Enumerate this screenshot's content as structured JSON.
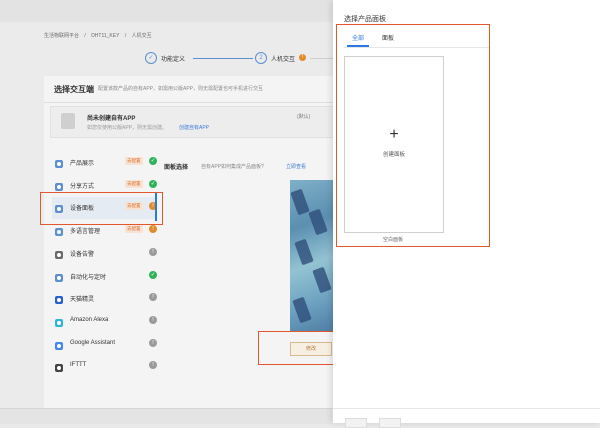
{
  "breadcrumb": {
    "items": [
      "生活物联网平台",
      "/",
      "DHT11_KEY",
      "/",
      "人机交互"
    ]
  },
  "steps": [
    {
      "num": "✓",
      "label": "功能定义"
    },
    {
      "num": "2",
      "label": "人机交互"
    }
  ],
  "section": {
    "title": "选择交互端",
    "desc": "配置该款产品的自有APP。如需用公版APP，则无需配置也可手机进行交互"
  },
  "app_card": {
    "title": "尚未创建自有APP",
    "subtitle": "如您仅使用公版APP，则无需创建。",
    "link": "创建自有APP",
    "default_label": "(默认)"
  },
  "menu": [
    {
      "label": "产品展示",
      "tag": "去配置",
      "status": "ok",
      "status_glyph": "✓",
      "icon": "product-display-icon"
    },
    {
      "label": "分享方式",
      "tag": "去配置",
      "status": "ok",
      "status_glyph": "✓",
      "icon": "share-icon"
    },
    {
      "label": "设备面板",
      "tag": "去配置",
      "status": "warn",
      "status_glyph": "!",
      "icon": "device-panel-icon"
    },
    {
      "label": "多语言管理",
      "tag": "去配置",
      "status": "warn",
      "status_glyph": "!",
      "icon": "language-icon"
    },
    {
      "label": "设备告警",
      "tag": "",
      "status": "gray",
      "status_glyph": "!",
      "icon": "alarm-icon"
    },
    {
      "label": "自动化与定时",
      "tag": "",
      "status": "ok",
      "status_glyph": "✓",
      "icon": "automation-icon"
    },
    {
      "label": "天猫精灵",
      "tag": "",
      "status": "gray",
      "status_glyph": "!",
      "icon": "tmall-genie-icon"
    },
    {
      "label": "Amazon Alexa",
      "tag": "",
      "status": "gray",
      "status_glyph": "!",
      "icon": "amazon-alexa-icon"
    },
    {
      "label": "Google Assistant",
      "tag": "",
      "status": "gray",
      "status_glyph": "!",
      "icon": "google-assistant-icon"
    },
    {
      "label": "IFTTT",
      "tag": "",
      "status": "gray",
      "status_glyph": "!",
      "icon": "ifttt-icon"
    }
  ],
  "panel": {
    "title": "面板选择",
    "question": "自有APP如何集成产品面板?",
    "link": "立即查看",
    "button_label": "修改"
  },
  "drawer": {
    "title": "选择产品面板",
    "tabs": [
      "全部",
      "面板"
    ],
    "create_plus": "+",
    "create_label": "创建面板",
    "create_caption": "空白面板",
    "footer_buttons": [
      "",
      ""
    ]
  },
  "colors": {
    "accent": "#2b78e4",
    "highlight": "#e0582b",
    "ok": "#2fb35a",
    "warn": "#e28b2a"
  }
}
